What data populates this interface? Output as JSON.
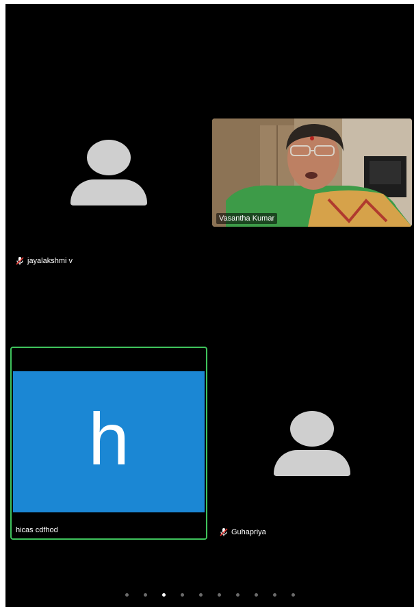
{
  "participants": [
    {
      "name": "jayalakshmi v",
      "muted": true,
      "type": "avatar"
    },
    {
      "name": "Vasantha Kumar",
      "muted": false,
      "type": "video"
    },
    {
      "name": "hicas cdfhod",
      "muted": false,
      "type": "initial",
      "initial": "h",
      "tile_color": "#1b87d4",
      "active_speaker": true,
      "highlight_color": "#3fc35c"
    },
    {
      "name": "Guhapriya",
      "muted": true,
      "type": "avatar"
    }
  ],
  "pager": {
    "page_count": 10,
    "current_page": 3
  }
}
